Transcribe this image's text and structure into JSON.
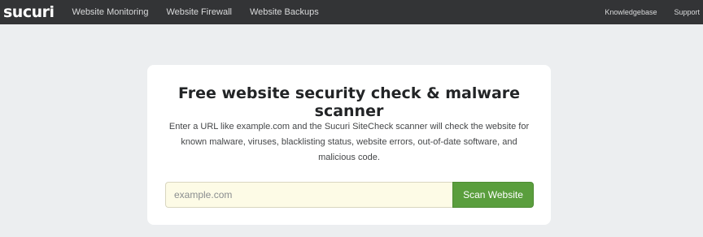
{
  "header": {
    "logo_text": "sucuri",
    "nav_left": [
      "Website Monitoring",
      "Website Firewall",
      "Website Backups"
    ],
    "nav_right": [
      "Knowledgebase",
      "Support"
    ]
  },
  "card": {
    "title": "Free website security check & malware scanner",
    "description": "Enter a URL like example.com and the Sucuri SiteCheck scanner will check the website for known malware, viruses, blacklisting status, website errors, out-of-date software, and malicious code.",
    "input_value": "",
    "input_placeholder": "example.com",
    "button_label": "Scan Website"
  },
  "colors": {
    "topbar": "#333436",
    "background": "#eceef0",
    "button": "#5a9e3d",
    "input_background": "#fdfbe6"
  }
}
